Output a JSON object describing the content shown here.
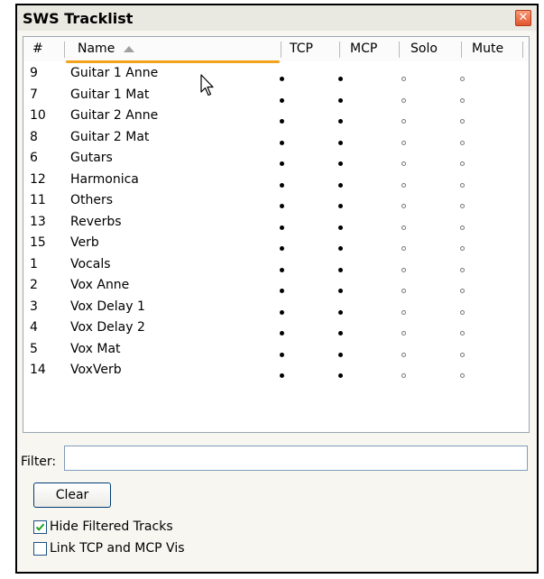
{
  "window": {
    "title": "SWS Tracklist",
    "close_glyph": "✕"
  },
  "columns": [
    {
      "key": "num",
      "label": "#"
    },
    {
      "key": "name",
      "label": "Name"
    },
    {
      "key": "tcp",
      "label": "TCP"
    },
    {
      "key": "mcp",
      "label": "MCP"
    },
    {
      "key": "solo",
      "label": "Solo"
    },
    {
      "key": "mute",
      "label": "Mute"
    }
  ],
  "sort": {
    "column": "Name",
    "direction": "ascending"
  },
  "tracks": [
    {
      "num": "9",
      "name": "Guitar 1 Anne",
      "tcp": true,
      "mcp": true,
      "solo": false,
      "mute": false
    },
    {
      "num": "7",
      "name": "Guitar 1 Mat",
      "tcp": true,
      "mcp": true,
      "solo": false,
      "mute": false
    },
    {
      "num": "10",
      "name": "Guitar 2 Anne",
      "tcp": true,
      "mcp": true,
      "solo": false,
      "mute": false
    },
    {
      "num": "8",
      "name": "Guitar 2 Mat",
      "tcp": true,
      "mcp": true,
      "solo": false,
      "mute": false
    },
    {
      "num": "6",
      "name": "Gutars",
      "tcp": true,
      "mcp": true,
      "solo": false,
      "mute": false
    },
    {
      "num": "12",
      "name": "Harmonica",
      "tcp": true,
      "mcp": true,
      "solo": false,
      "mute": false
    },
    {
      "num": "11",
      "name": "Others",
      "tcp": true,
      "mcp": true,
      "solo": false,
      "mute": false
    },
    {
      "num": "13",
      "name": "Reverbs",
      "tcp": true,
      "mcp": true,
      "solo": false,
      "mute": false
    },
    {
      "num": "15",
      "name": "Verb",
      "tcp": true,
      "mcp": true,
      "solo": false,
      "mute": false
    },
    {
      "num": "1",
      "name": "Vocals",
      "tcp": true,
      "mcp": true,
      "solo": false,
      "mute": false
    },
    {
      "num": "2",
      "name": "Vox Anne",
      "tcp": true,
      "mcp": true,
      "solo": false,
      "mute": false
    },
    {
      "num": "3",
      "name": "Vox Delay 1",
      "tcp": true,
      "mcp": true,
      "solo": false,
      "mute": false
    },
    {
      "num": "4",
      "name": "Vox Delay 2",
      "tcp": true,
      "mcp": true,
      "solo": false,
      "mute": false
    },
    {
      "num": "5",
      "name": "Vox Mat",
      "tcp": true,
      "mcp": true,
      "solo": false,
      "mute": false
    },
    {
      "num": "14",
      "name": "VoxVerb",
      "tcp": true,
      "mcp": true,
      "solo": false,
      "mute": false
    }
  ],
  "filter": {
    "label": "Filter:",
    "value": ""
  },
  "clear_button": {
    "label": "Clear"
  },
  "options": {
    "hide_filtered": {
      "label": "Hide Filtered Tracks",
      "checked": true
    },
    "link_vis": {
      "label": "Link TCP and MCP Vis",
      "checked": false
    }
  },
  "colors": {
    "sort_accent": "#f2a21b",
    "close_button": "#e2552c",
    "checkmark": "#21a121"
  },
  "icons": {
    "close": "close-icon",
    "sort": "sort-ascending-icon",
    "cursor": "mouse-pointer-icon",
    "check": "checkmark-icon"
  }
}
